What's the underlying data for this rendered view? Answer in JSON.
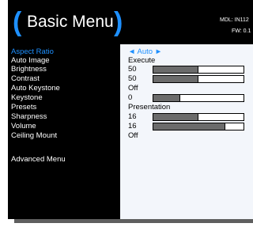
{
  "header": {
    "title": "Basic Menu",
    "paren_open": "(",
    "paren_close": ")",
    "model_text": "MDL: IN112",
    "fw_text": "FW: 0.1"
  },
  "menu": {
    "items": [
      {
        "label": "Aspect Ratio",
        "value": "◄ Auto ►",
        "selected": true
      },
      {
        "label": "Auto Image",
        "value": "Execute"
      },
      {
        "label": "Brightness",
        "value": "50",
        "bar": 0.5
      },
      {
        "label": "Contrast",
        "value": "50",
        "bar": 0.5
      },
      {
        "label": "Auto Keystone",
        "value": "Off"
      },
      {
        "label": "Keystone",
        "value": "0",
        "bar": 0.3
      },
      {
        "label": "Presets",
        "value": "Presentation"
      },
      {
        "label": "Sharpness",
        "value": "16",
        "bar": 0.5
      },
      {
        "label": "Volume",
        "value": "16",
        "bar": 0.8
      },
      {
        "label": "Ceiling Mount",
        "value": "Off"
      }
    ],
    "advanced_label": "Advanced Menu"
  },
  "colors": {
    "accent": "#1e90ff",
    "panel_bg": "#000000",
    "value_bg": "#f3f6fb",
    "bar_fill": "#6b6b6b"
  }
}
